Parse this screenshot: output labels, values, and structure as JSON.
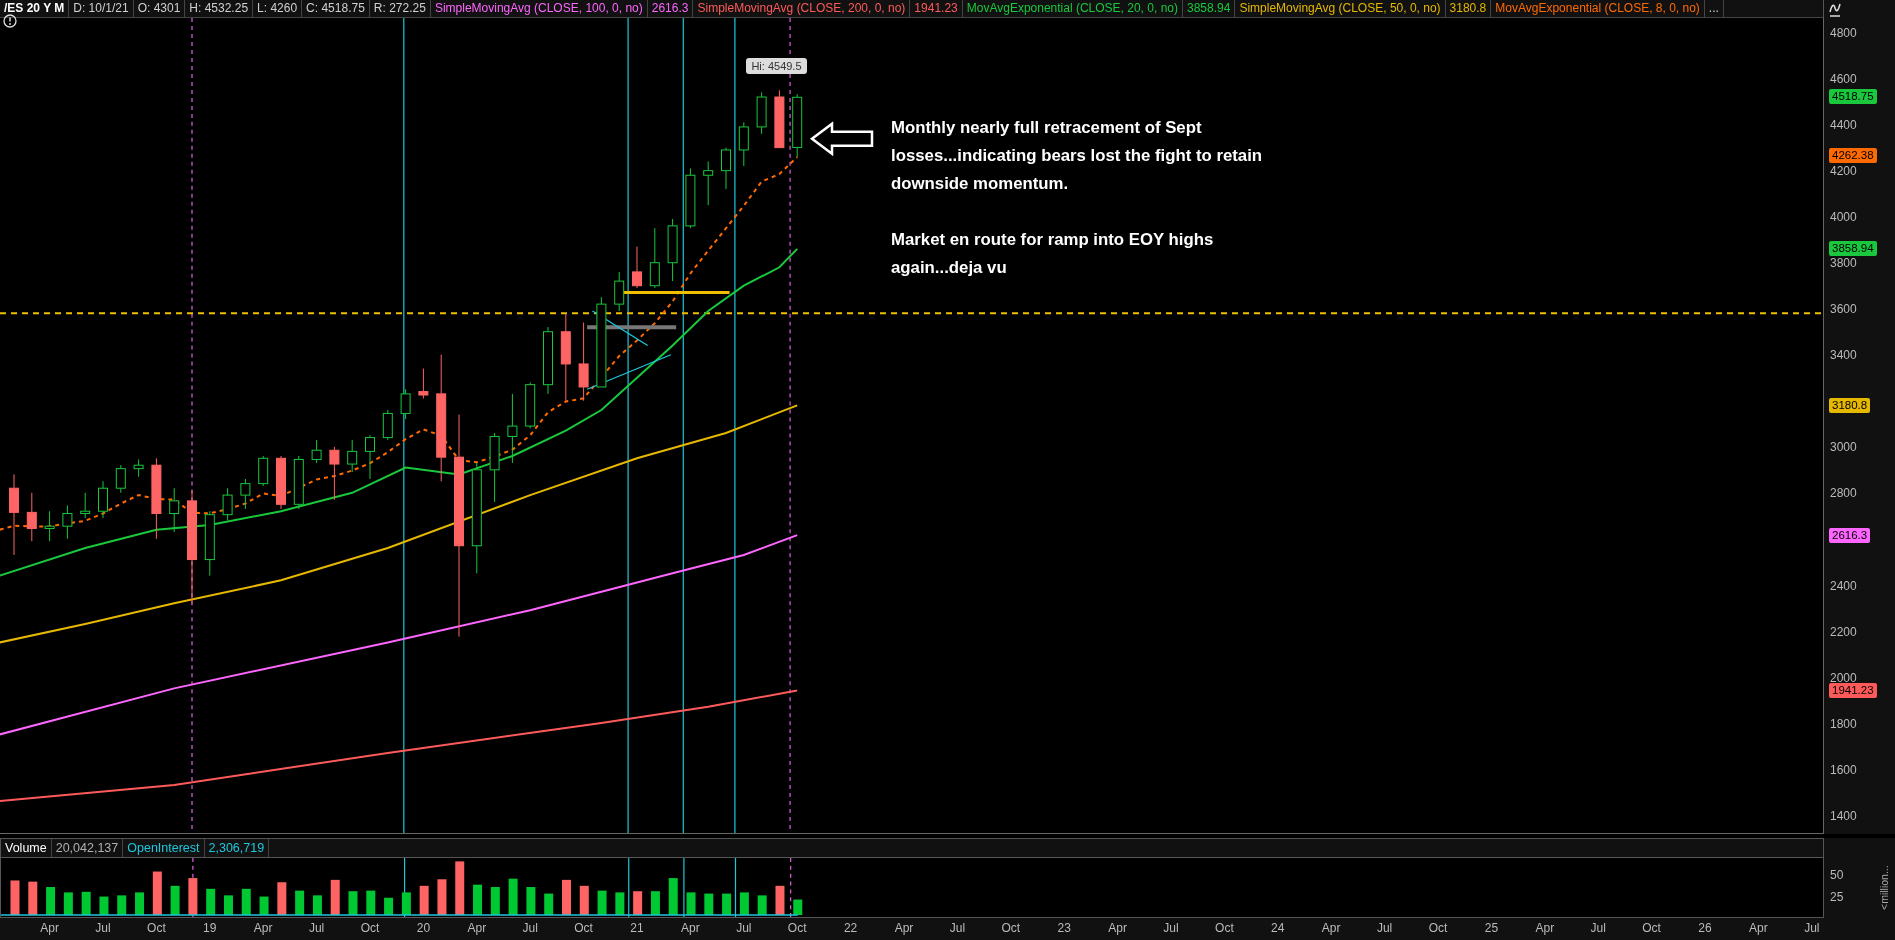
{
  "legend": [
    {
      "text": "/ES 20 Y M",
      "color": "#ffffff"
    },
    {
      "text": "D: 10/1/21",
      "color": "#d0d0d0"
    },
    {
      "text": "O: 4301",
      "color": "#d0d0d0"
    },
    {
      "text": "H: 4532.25",
      "color": "#d0d0d0"
    },
    {
      "text": "L: 4260",
      "color": "#d0d0d0"
    },
    {
      "text": "C: 4518.75",
      "color": "#d0d0d0"
    },
    {
      "text": "R: 272.25",
      "color": "#d0d0d0"
    },
    {
      "text": "SimpleMovingAvg (CLOSE, 100, 0, no)",
      "color": "#ff66ff"
    },
    {
      "text": "2616.3",
      "color": "#ff66ff"
    },
    {
      "text": "SimpleMovingAvg (CLOSE, 200, 0, no)",
      "color": "#ff5a5a"
    },
    {
      "text": "1941.23",
      "color": "#ff5a5a"
    },
    {
      "text": "MovAvgExponential (CLOSE, 20, 0, no)",
      "color": "#19c83c"
    },
    {
      "text": "3858.94",
      "color": "#19c83c"
    },
    {
      "text": "SimpleMovingAvg (CLOSE, 50, 0, no)",
      "color": "#e6b800"
    },
    {
      "text": "3180.8",
      "color": "#e6b800"
    },
    {
      "text": "MovAvgExponential (CLOSE, 8, 0, no)",
      "color": "#ff6a00"
    },
    {
      "text": "..."
    }
  ],
  "price_chart": {
    "hi_label": "Hi: 4549.5",
    "annotation": [
      "Monthly nearly full retracement of Sept losses...indicating bears lost the fight to retain downside momentum.",
      "Market en route for ramp into EOY highs again...deja vu"
    ],
    "price_ticks": [
      "4800",
      "4600",
      "4400",
      "4200",
      "4000",
      "3800",
      "3600",
      "3400",
      "3000",
      "2800",
      "2400",
      "2200",
      "2000",
      "1800",
      "1600",
      "1400"
    ],
    "price_tags": [
      {
        "text": "4518.75",
        "color": "#19c83c"
      },
      {
        "text": "4262.38",
        "color": "#ff6a00"
      },
      {
        "text": "3858.94",
        "color": "#19c83c"
      },
      {
        "text": "3180.8",
        "color": "#e6b800"
      },
      {
        "text": "2616.3",
        "color": "#ff66ff"
      },
      {
        "text": "1941.23",
        "color": "#ff5a5a"
      }
    ]
  },
  "volume_pane": {
    "labels": [
      {
        "text": "Volume",
        "color": "#ffffff"
      },
      {
        "text": "20,042,137",
        "color": "#b0b0b0"
      },
      {
        "text": "OpenInterest",
        "color": "#1ec8dc"
      },
      {
        "text": "2,306,719",
        "color": "#1ec8dc"
      }
    ],
    "ticks": [
      "50",
      "25"
    ],
    "unit_label": "<million..."
  },
  "x_axis": [
    "Apr",
    "Jul",
    "Oct",
    "19",
    "Apr",
    "Jul",
    "Oct",
    "20",
    "Apr",
    "Jul",
    "Oct",
    "21",
    "Apr",
    "Jul",
    "Oct",
    "22",
    "Apr",
    "Jul",
    "Oct",
    "23",
    "Apr",
    "Jul",
    "Oct",
    "24",
    "Apr",
    "Jul",
    "Oct",
    "25",
    "Apr",
    "Jul",
    "Oct",
    "26",
    "Apr",
    "Jul"
  ]
}
